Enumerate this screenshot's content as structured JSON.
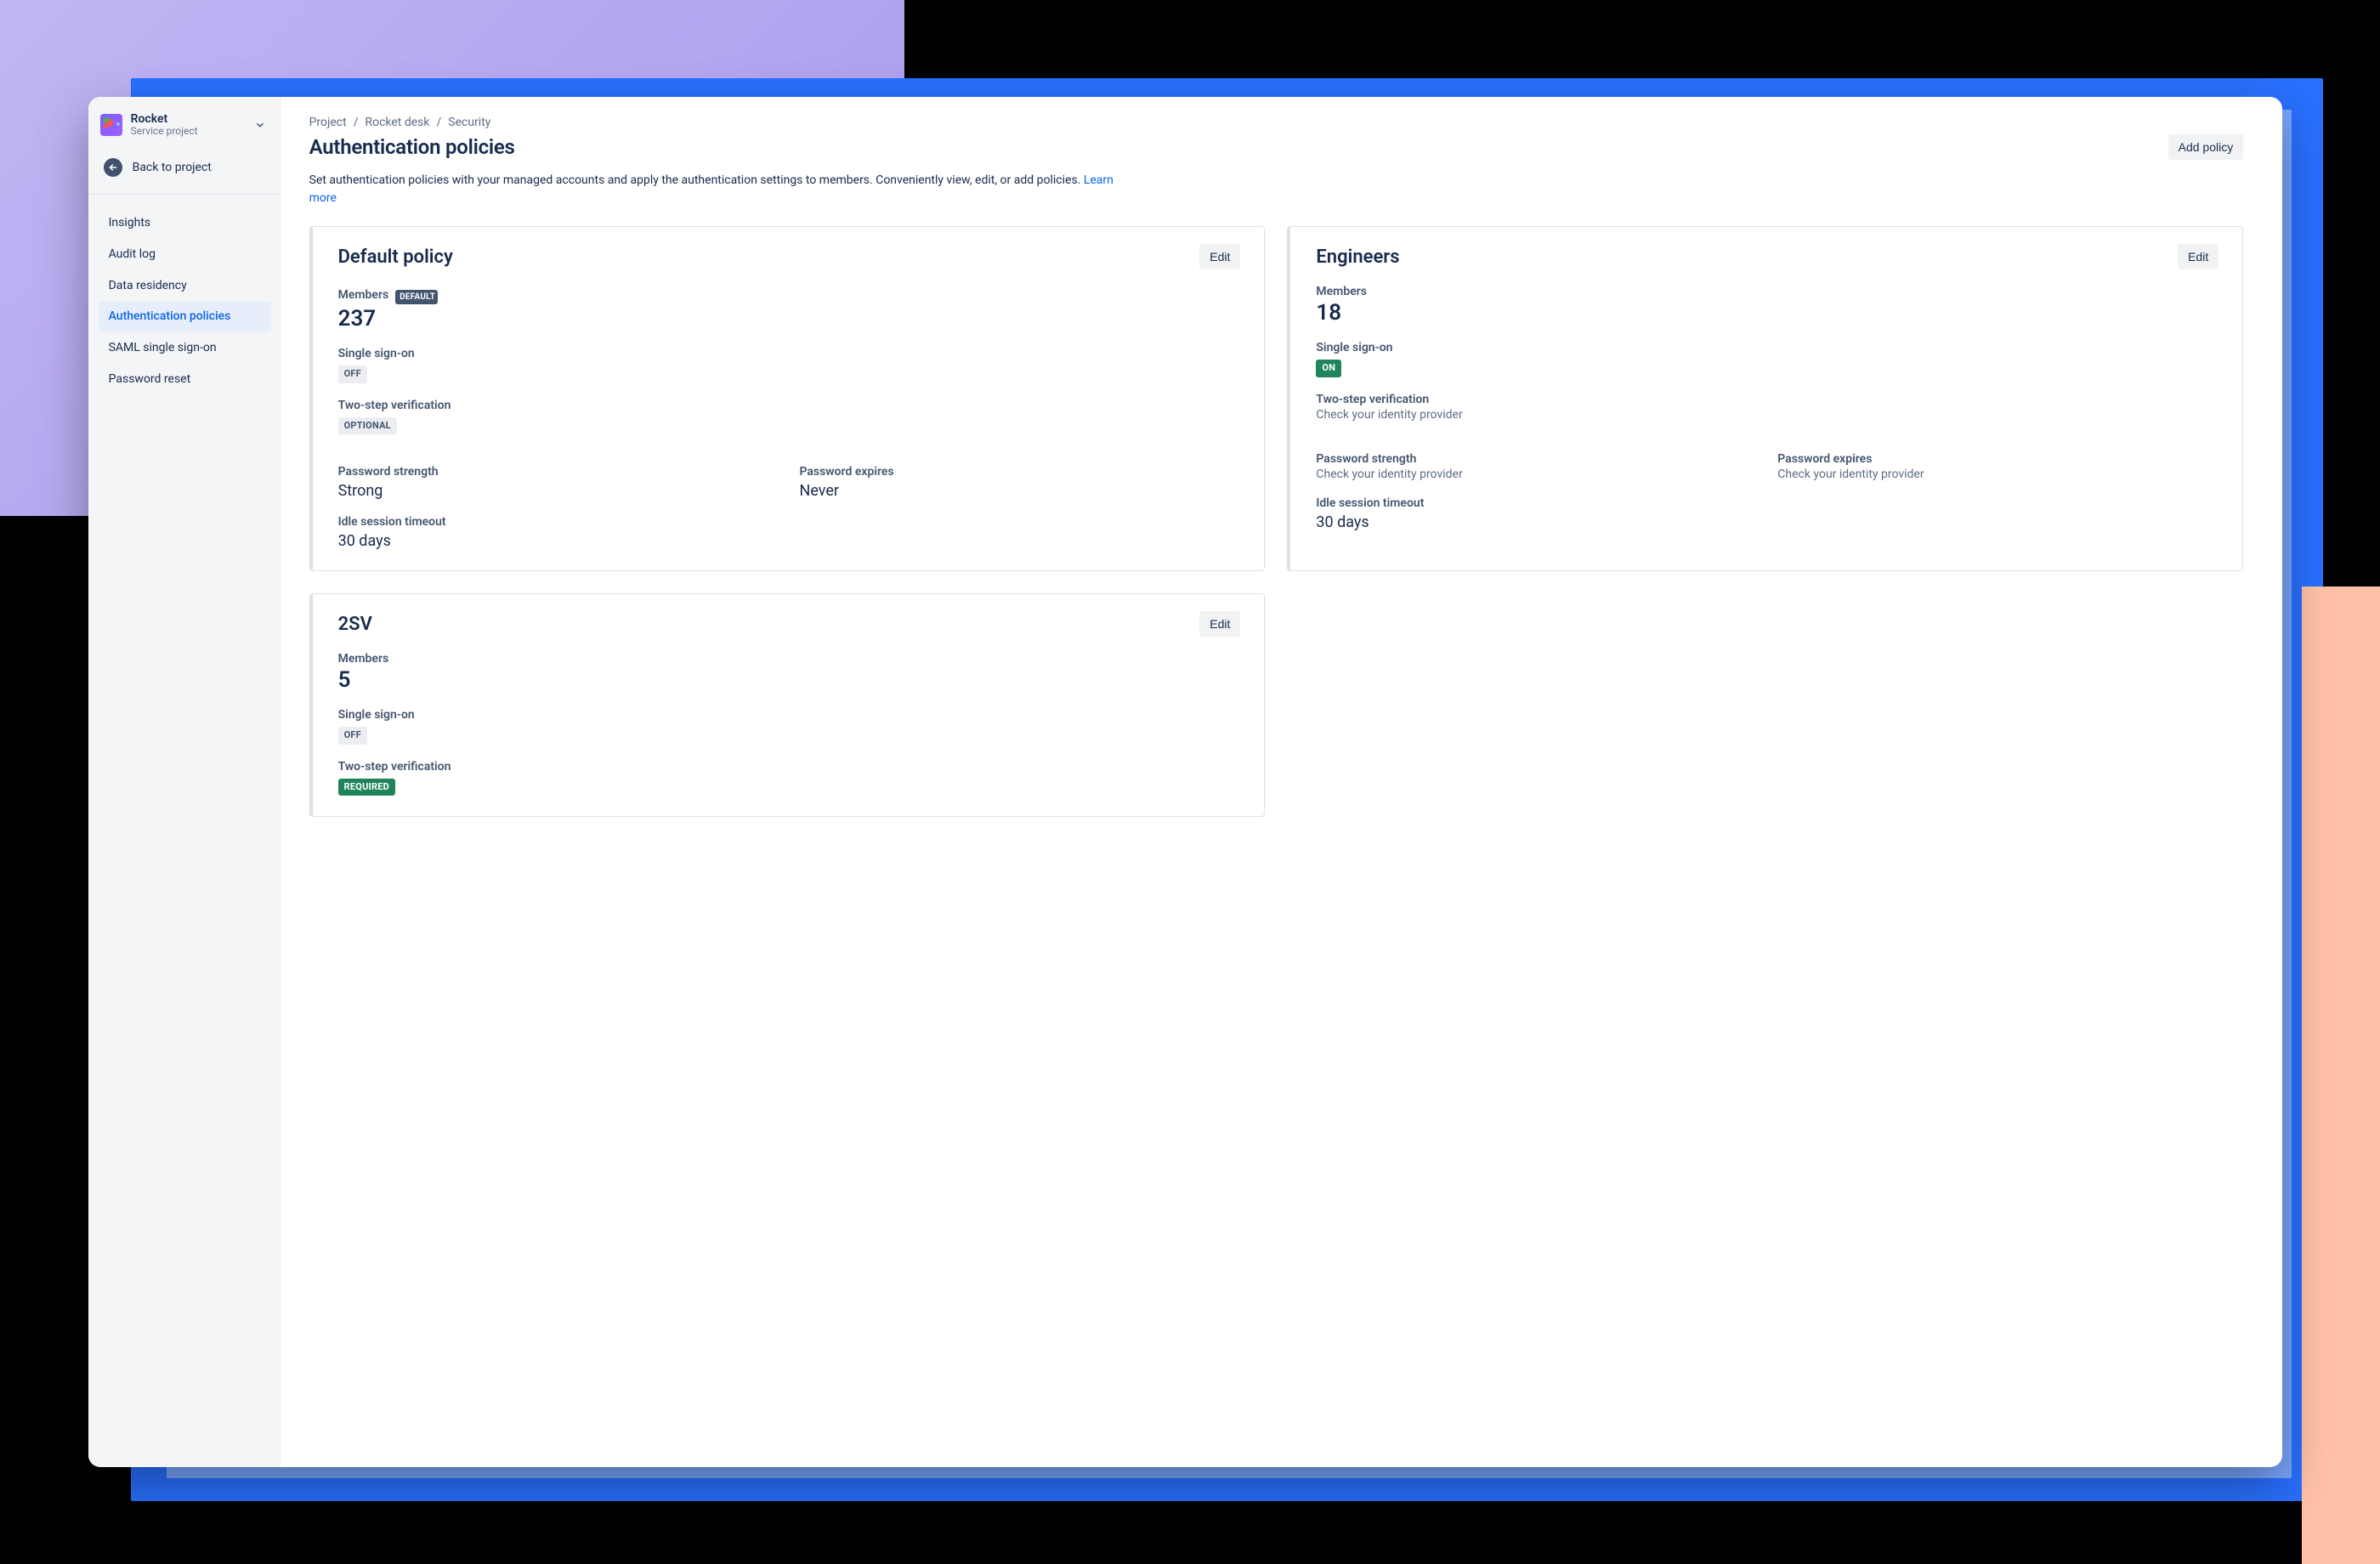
{
  "sidebar": {
    "project": {
      "name": "Rocket",
      "subtitle": "Service project"
    },
    "back_label": "Back to project",
    "items": [
      {
        "label": "Insights"
      },
      {
        "label": "Audit log"
      },
      {
        "label": "Data residency"
      },
      {
        "label": "Authentication policies",
        "active": true
      },
      {
        "label": "SAML single sign-on"
      },
      {
        "label": "Password reset"
      }
    ]
  },
  "breadcrumbs": [
    "Project",
    "Rocket desk",
    "Security"
  ],
  "page": {
    "title": "Authentication policies",
    "add_button": "Add policy",
    "subtext_before": "Set authentication policies with your managed accounts and apply the authentication settings to members. Conveniently view, edit, or add policies. ",
    "learn_more": "Learn more"
  },
  "labels": {
    "members": "Members",
    "sso": "Single sign-on",
    "tsv": "Two-step verification",
    "pwd_strength": "Password strength",
    "pwd_expires": "Password expires",
    "idle": "Idle session timeout",
    "edit": "Edit",
    "default_badge": "DEFAULT"
  },
  "policies": [
    {
      "name": "Default policy",
      "is_default": true,
      "members": "237",
      "sso_badge": "OFF",
      "sso_style": "off",
      "tsv_badge": "OPTIONAL",
      "tsv_style": "opt",
      "tsv_text": null,
      "pwd_strength": "Strong",
      "pwd_expires": "Never",
      "pwd_idp": false,
      "idle": "30 days"
    },
    {
      "name": "Engineers",
      "is_default": false,
      "members": "18",
      "sso_badge": "ON",
      "sso_style": "on",
      "tsv_badge": null,
      "tsv_style": null,
      "tsv_text": "Check your identity provider",
      "pwd_strength": "Check your identity provider",
      "pwd_expires": "Check your identity provider",
      "pwd_idp": true,
      "idle": "30 days"
    },
    {
      "name": "2SV",
      "is_default": false,
      "members": "5",
      "sso_badge": "OFF",
      "sso_style": "off",
      "tsv_badge": "REQUIRED",
      "tsv_style": "req",
      "tsv_text": null,
      "pwd_strength": null,
      "pwd_expires": null,
      "pwd_idp": false,
      "idle": null
    }
  ]
}
